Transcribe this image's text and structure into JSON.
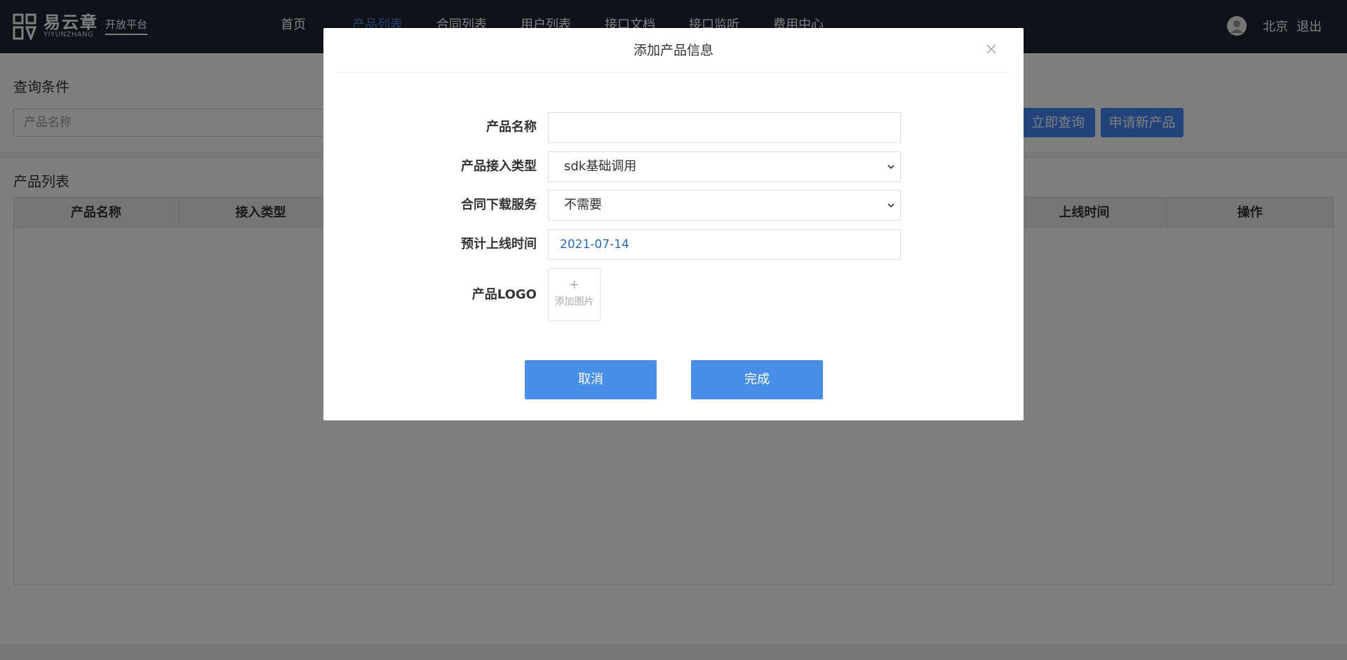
{
  "header": {
    "logo_cn": "易云章",
    "logo_en": "YIYUNZHANG",
    "logo_platform": "开放平台",
    "nav": [
      "首页",
      "产品列表",
      "合同列表",
      "用户列表",
      "接口文档",
      "接口监听",
      "费用中心"
    ],
    "active_nav": "产品列表",
    "user_name": "北京",
    "logout_label": "退出"
  },
  "query": {
    "title": "查询条件",
    "product_name_placeholder": "产品名称",
    "search_button": "立即查询",
    "apply_button": "申请新产品"
  },
  "list": {
    "title": "产品列表",
    "columns": [
      "产品名称",
      "接入类型",
      "",
      "",
      "",
      "",
      "上线时间",
      "操作"
    ]
  },
  "modal": {
    "title": "添加产品信息",
    "fields": {
      "product_name_label": "产品名称",
      "product_name_value": "",
      "access_type_label": "产品接入类型",
      "access_type_value": "sdk基础调用",
      "contract_download_label": "合同下载服务",
      "contract_download_value": "不需要",
      "launch_date_label": "预计上线时间",
      "launch_date_value": "2021-07-14",
      "logo_label": "产品LOGO",
      "upload_plus": "+",
      "upload_text": "添加图片"
    },
    "cancel_label": "取消",
    "done_label": "完成"
  },
  "colors": {
    "header_bg": "#1f2733",
    "accent": "#4285f4",
    "modal_button": "#4a8fe7",
    "active_nav": "#4f7fd8"
  },
  "icons": [
    "logo-mark-icon",
    "user-avatar-icon",
    "close-icon",
    "chevron-down-icon"
  ]
}
